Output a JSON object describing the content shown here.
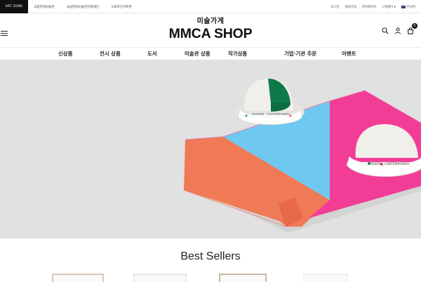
{
  "topbar": {
    "art_zone": "ART ZONE",
    "links": [
      "국립현대미술관",
      "국립현대미술관문화재단",
      "오프라인이트존"
    ],
    "utility": [
      "로그인",
      "회원가입",
      "마이페이지",
      "고객센터"
    ],
    "language": "한국어"
  },
  "header": {
    "brand_korean": "미술가게",
    "brand_title": "MMCA SHOP",
    "cart_count": "0"
  },
  "nav": {
    "items": [
      "신상품",
      "전시 상품",
      "도서",
      "미술관 상품",
      "작가상품",
      "기업·기관 주문",
      "이벤트"
    ]
  },
  "hero": {
    "hat_band_left": "MODERN · CONTEMPORARY",
    "hat_band_right": "MODERN · CONTEMPORARY",
    "colors": {
      "background": "#e1e1e1",
      "blue": "#6ec8ef",
      "orange": "#f07a55",
      "pink": "#f23d96"
    }
  },
  "best_sellers": {
    "title": "Best Sellers"
  }
}
